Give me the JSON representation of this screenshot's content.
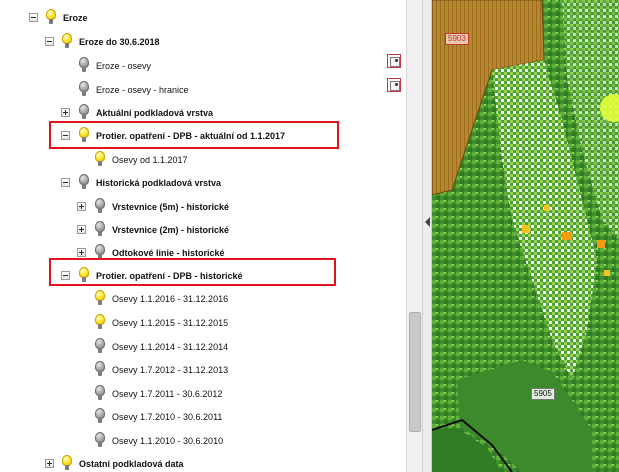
{
  "tree": {
    "rows": [
      {
        "label": "Eroze",
        "bold": true,
        "bulb": "on",
        "toggle": "minus"
      },
      {
        "label": "Eroze do 30.6.2018",
        "bold": true,
        "bulb": "on",
        "toggle": "minus"
      },
      {
        "label": "Eroze - osevy",
        "bold": false,
        "bulb": "off",
        "toggle": null
      },
      {
        "label": "Eroze - osevy - hranice",
        "bold": false,
        "bulb": "off",
        "toggle": null
      },
      {
        "label": "Aktuální podkladová vrstva",
        "bold": true,
        "bulb": "off",
        "toggle": "plus"
      },
      {
        "label": "Protier. opatření - DPB - aktuální od 1.1.2017",
        "bold": true,
        "bulb": "on",
        "toggle": "minus"
      },
      {
        "label": "Osevy od 1.1.2017",
        "bold": false,
        "bulb": "on",
        "toggle": null
      },
      {
        "label": "Historická podkladová vrstva",
        "bold": true,
        "bulb": "off",
        "toggle": "minus"
      },
      {
        "label": "Vrstevnice (5m) - historické",
        "bold": true,
        "bulb": "off",
        "toggle": "plus"
      },
      {
        "label": "Vrstevnice (2m) - historické",
        "bold": true,
        "bulb": "off",
        "toggle": "plus"
      },
      {
        "label": "Odtokové linie - historické",
        "bold": true,
        "bulb": "off",
        "toggle": "plus"
      },
      {
        "label": "Protier. opatření - DPB - historické",
        "bold": true,
        "bulb": "on",
        "toggle": "minus"
      },
      {
        "label": "Osevy 1.1.2016 - 31.12.2016",
        "bold": false,
        "bulb": "on",
        "toggle": null
      },
      {
        "label": "Osevy 1.1.2015 - 31.12.2015",
        "bold": false,
        "bulb": "on",
        "toggle": null
      },
      {
        "label": "Osevy 1.1.2014 - 31.12.2014",
        "bold": false,
        "bulb": "off",
        "toggle": null
      },
      {
        "label": "Osevy 1.7.2012 - 31.12.2013",
        "bold": false,
        "bulb": "off",
        "toggle": null
      },
      {
        "label": "Osevy 1.7.2011 - 30.6.2012",
        "bold": false,
        "bulb": "off",
        "toggle": null
      },
      {
        "label": "Osevy 1.7.2010 - 30.6.2011",
        "bold": false,
        "bulb": "off",
        "toggle": null
      },
      {
        "label": "Osevy 1.1.2010 - 30.6.2010",
        "bold": false,
        "bulb": "off",
        "toggle": null
      },
      {
        "label": "Ostatní podkladová data",
        "bold": true,
        "bulb": "on",
        "toggle": "plus"
      }
    ]
  },
  "map": {
    "parcel_labels": {
      "top": "5903",
      "bottom": "5905"
    }
  },
  "colors": {
    "highlight": "#e0141a",
    "bulb_on": "#ffec3a",
    "bulb_off": "#a8a8a8"
  }
}
